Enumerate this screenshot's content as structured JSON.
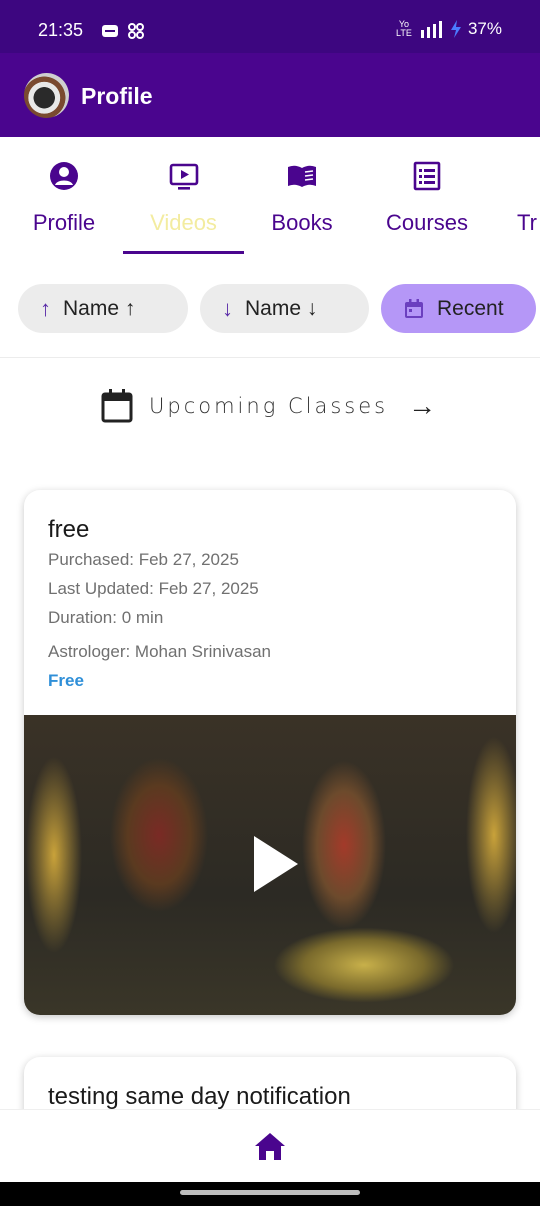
{
  "status_bar": {
    "time": "21:35",
    "network_label": "Yo LTE",
    "signal": "5G",
    "battery": "37%"
  },
  "app_bar": {
    "title": "Profile"
  },
  "tabs": [
    {
      "label": "Profile",
      "icon": "account-circle-icon"
    },
    {
      "label": "Videos",
      "icon": "tv-play-icon",
      "active": true
    },
    {
      "label": "Books",
      "icon": "book-open-icon"
    },
    {
      "label": "Courses",
      "icon": "list-icon"
    },
    {
      "label": "Tr",
      "icon": "partial-tab-icon"
    }
  ],
  "sort_chips": [
    {
      "label": "Name ↑",
      "icon": "arrow-up-icon"
    },
    {
      "label": "Name ↓",
      "icon": "arrow-down-icon"
    },
    {
      "label": "Recent",
      "icon": "calendar-icon",
      "active": true
    }
  ],
  "upcoming": {
    "label": "Upcoming Classes"
  },
  "videos": [
    {
      "title": "free",
      "purchased": "Purchased: Feb 27, 2025",
      "last_updated": "Last Updated: Feb 27, 2025",
      "duration": "Duration: 0 min",
      "astrologer": "Astrologer: Mohan Srinivasan",
      "price": "Free"
    },
    {
      "title": "testing same day notification"
    }
  ],
  "colors": {
    "primary": "#4a058e",
    "status_bar": "#3d0680",
    "active_chip": "#b597f7",
    "active_tab_label": "#f3eca0",
    "price": "#2f8fd8"
  }
}
